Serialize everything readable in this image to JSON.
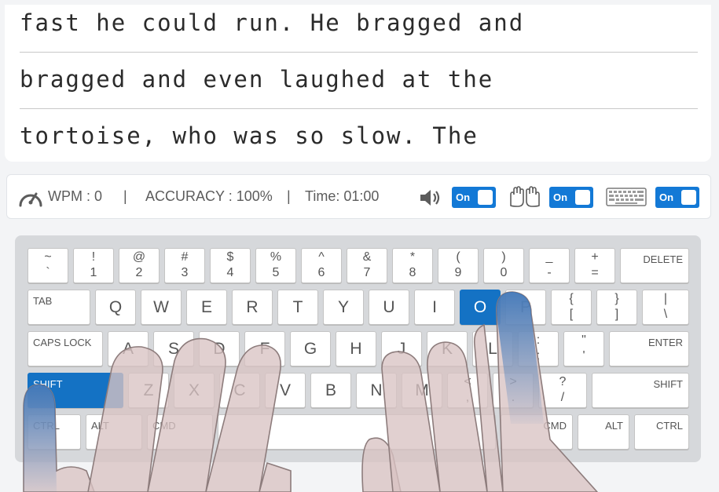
{
  "passage": {
    "lines": [
      "fast he could run. He bragged and",
      "bragged and even laughed at the",
      "tortoise, who was so slow. The"
    ]
  },
  "status": {
    "wpm": "WPM : 0",
    "separator": "|",
    "accuracy": "ACCURACY : 100%",
    "time": "Time: 01:00",
    "toggles": {
      "sound": "On",
      "hands": "On",
      "keyboard": "On"
    },
    "icons": [
      "speedometer-icon",
      "speaker-icon",
      "hands-icon",
      "keyboard-icon"
    ]
  },
  "keyboard": {
    "active_keys": [
      "O",
      "SHIFT"
    ],
    "active_color": "#1472c4",
    "row1": [
      {
        "top": "~",
        "bot": "`"
      },
      {
        "top": "!",
        "bot": "1"
      },
      {
        "top": "@",
        "bot": "2"
      },
      {
        "top": "#",
        "bot": "3"
      },
      {
        "top": "$",
        "bot": "4"
      },
      {
        "top": "%",
        "bot": "5"
      },
      {
        "top": "^",
        "bot": "6"
      },
      {
        "top": "&",
        "bot": "7"
      },
      {
        "top": "*",
        "bot": "8"
      },
      {
        "top": "(",
        "bot": "9"
      },
      {
        "top": ")",
        "bot": "0"
      },
      {
        "top": "_",
        "bot": "-"
      },
      {
        "top": "+",
        "bot": "="
      }
    ],
    "delete": "DELETE",
    "tab": "TAB",
    "row2": [
      "Q",
      "W",
      "E",
      "R",
      "T",
      "Y",
      "U",
      "I",
      "O",
      "P"
    ],
    "row2_sym": [
      {
        "top": "{",
        "bot": "["
      },
      {
        "top": "}",
        "bot": "]"
      },
      {
        "top": "|",
        "bot": "\\"
      }
    ],
    "caps": "CAPS LOCK",
    "row3": [
      "A",
      "S",
      "D",
      "F",
      "G",
      "H",
      "J",
      "K",
      "L"
    ],
    "row3_sym": [
      {
        "top": ":",
        "bot": ";"
      },
      {
        "top": "\"",
        "bot": "'"
      }
    ],
    "enter": "ENTER",
    "shift": "SHIFT",
    "row4": [
      "Z",
      "X",
      "C",
      "V",
      "B",
      "N",
      "M"
    ],
    "row4_sym": [
      {
        "top": "<",
        "bot": ","
      },
      {
        "top": ">",
        "bot": "."
      },
      {
        "top": "?",
        "bot": "/"
      }
    ],
    "shift_right": "SHIFT",
    "bottom": {
      "ctrl_left": "CTRL",
      "alt_left": "ALT",
      "cmd_left": "CMD",
      "cmd_right": "CMD",
      "alt_right": "ALT",
      "ctrl_right": "CTRL"
    }
  }
}
